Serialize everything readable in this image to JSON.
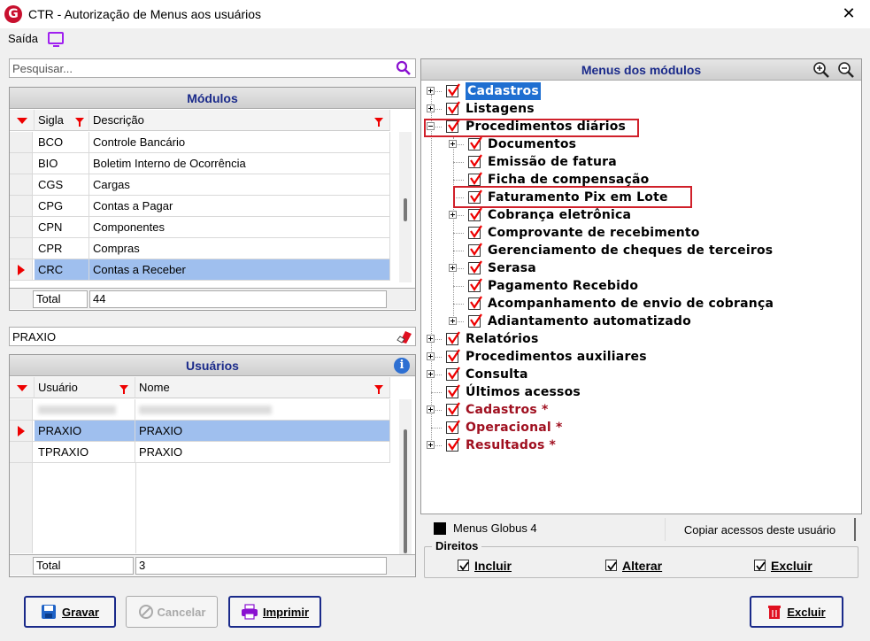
{
  "window": {
    "title": "CTR - Autorização de Menus aos usuários",
    "logo_letter": "G",
    "close_glyph": "✕"
  },
  "menu": {
    "saida": "Saída"
  },
  "search": {
    "placeholder": "Pesquisar..."
  },
  "modules": {
    "title": "Módulos",
    "columns": [
      "Sigla",
      "Descrição"
    ],
    "rows": [
      {
        "sigla": "BCO",
        "descricao": "Controle Bancário"
      },
      {
        "sigla": "BIO",
        "descricao": "Boletim Interno de Ocorrência"
      },
      {
        "sigla": "CGS",
        "descricao": "Cargas"
      },
      {
        "sigla": "CPG",
        "descricao": "Contas a Pagar"
      },
      {
        "sigla": "CPN",
        "descricao": "Componentes"
      },
      {
        "sigla": "CPR",
        "descricao": "Compras"
      },
      {
        "sigla": "CRC",
        "descricao": "Contas a Receber"
      }
    ],
    "selected_index": 6,
    "total_label": "Total",
    "total_value": "44"
  },
  "user_filter": {
    "value": "PRAXIO"
  },
  "users": {
    "title": "Usuários",
    "columns": [
      "Usuário",
      "Nome"
    ],
    "rows": [
      {
        "usuario": "PRAXIO",
        "nome": "PRAXIO"
      },
      {
        "usuario": "TPRAXIO",
        "nome": "PRAXIO"
      }
    ],
    "selected_index": 0,
    "total_label": "Total",
    "total_value": "3"
  },
  "tree": {
    "title": "Menus dos módulos",
    "nodes": {
      "cadastros": "Cadastros",
      "listagens": "Listagens",
      "procedimentos_diarios": "Procedimentos diários",
      "documentos": "Documentos",
      "emissao_fatura": "Emissão de fatura",
      "ficha_compensacao": "Ficha de compensação",
      "faturamento_pix": "Faturamento Pix em Lote",
      "cobranca_eletronica": "Cobrança eletrônica",
      "comprovante": "Comprovante de recebimento",
      "gerenciamento_cheques": "Gerenciamento de cheques de terceiros",
      "serasa": "Serasa",
      "pagamento_recebido": "Pagamento Recebido",
      "acompanhamento": "Acompanhamento de envio de cobrança",
      "adiantamento": "Adiantamento automatizado",
      "relatorios": "Relatórios",
      "procedimentos_auxiliares": "Procedimentos auxiliares",
      "consulta": "Consulta",
      "ultimos_acessos": "Últimos acessos",
      "cadastros_star": "Cadastros *",
      "operacional_star": "Operacional *",
      "resultados_star": "Resultados *"
    }
  },
  "globus": {
    "label": "Menus Globus 4",
    "copy_button": "Copiar acessos deste usuário"
  },
  "direitos": {
    "title": "Direitos",
    "incluir": "Incluir",
    "alterar": "Alterar",
    "excluir": "Excluir"
  },
  "buttons": {
    "gravar": "Gravar",
    "cancelar": "Cancelar",
    "imprimir": "Imprimir",
    "excluir": "Excluir"
  },
  "colors": {
    "accent_blue": "#1a2a8a",
    "selection": "#9fbfee",
    "marker_red": "#e00000",
    "highlight_red": "#d0202a"
  }
}
